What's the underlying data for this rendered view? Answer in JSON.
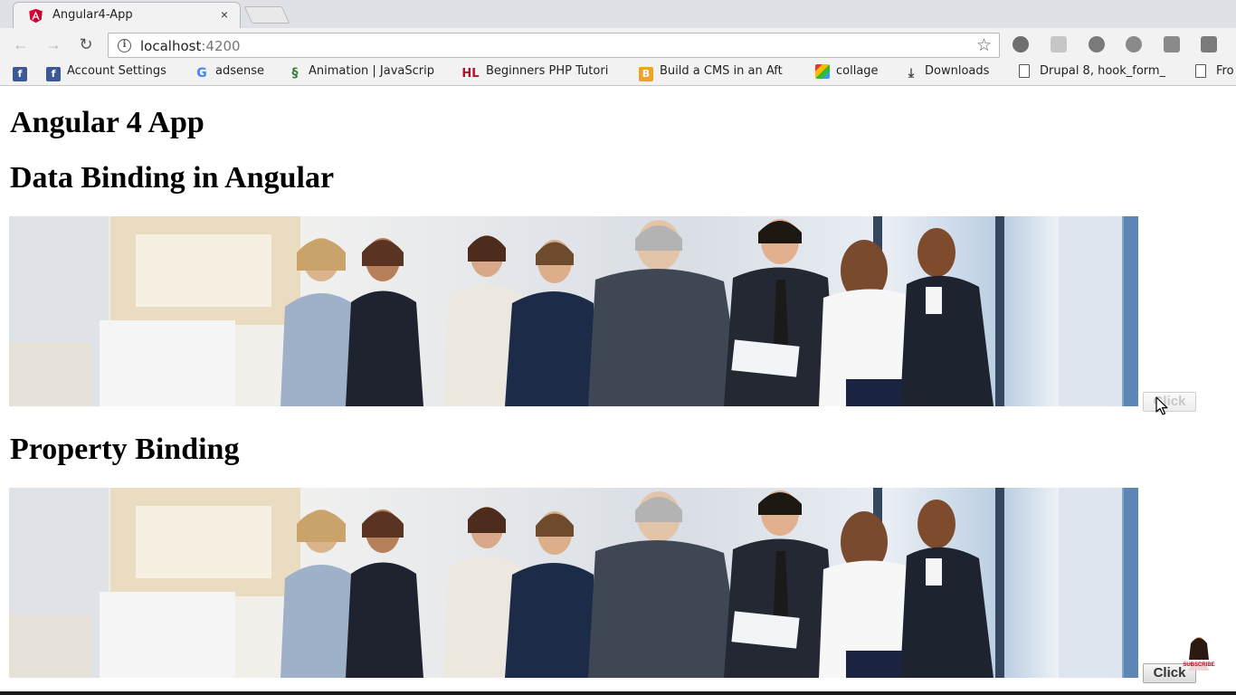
{
  "browser": {
    "tab": {
      "title": "Angular4-App",
      "close_symbol": "×"
    },
    "toolbar": {
      "url_host": "localhost",
      "url_port": ":4200",
      "extensions": [
        "angular-icon",
        "extension-icon",
        "gear-icon",
        "extension-icon",
        "jb-icon",
        "extension-icon"
      ]
    },
    "bookmarks": [
      {
        "label": "",
        "icon": "facebook-icon"
      },
      {
        "label": "Account Settings",
        "icon": "facebook-icon"
      },
      {
        "label": "adsense",
        "icon": "google-icon"
      },
      {
        "label": "Animation | JavaScrip",
        "icon": "animation-icon"
      },
      {
        "label": "Beginners PHP Tutori",
        "icon": "hl-icon"
      },
      {
        "label": "Build a CMS in an Aft",
        "icon": "cms-icon"
      },
      {
        "label": "collage",
        "icon": "collage-icon"
      },
      {
        "label": "Downloads",
        "icon": "download-icon"
      },
      {
        "label": "Drupal 8, hook_form_",
        "icon": "page-icon"
      },
      {
        "label": "Fro",
        "icon": "page-icon"
      }
    ]
  },
  "page": {
    "title": "Angular 4 App",
    "section1_heading": "Data Binding in Angular",
    "section2_heading": "Property Binding",
    "button1_label": "Click",
    "button2_label": "Click",
    "watermark_text": "SUBSCRIBE"
  },
  "colors": {
    "angular_red": "#dd0031",
    "facebook_blue": "#3b5998"
  }
}
